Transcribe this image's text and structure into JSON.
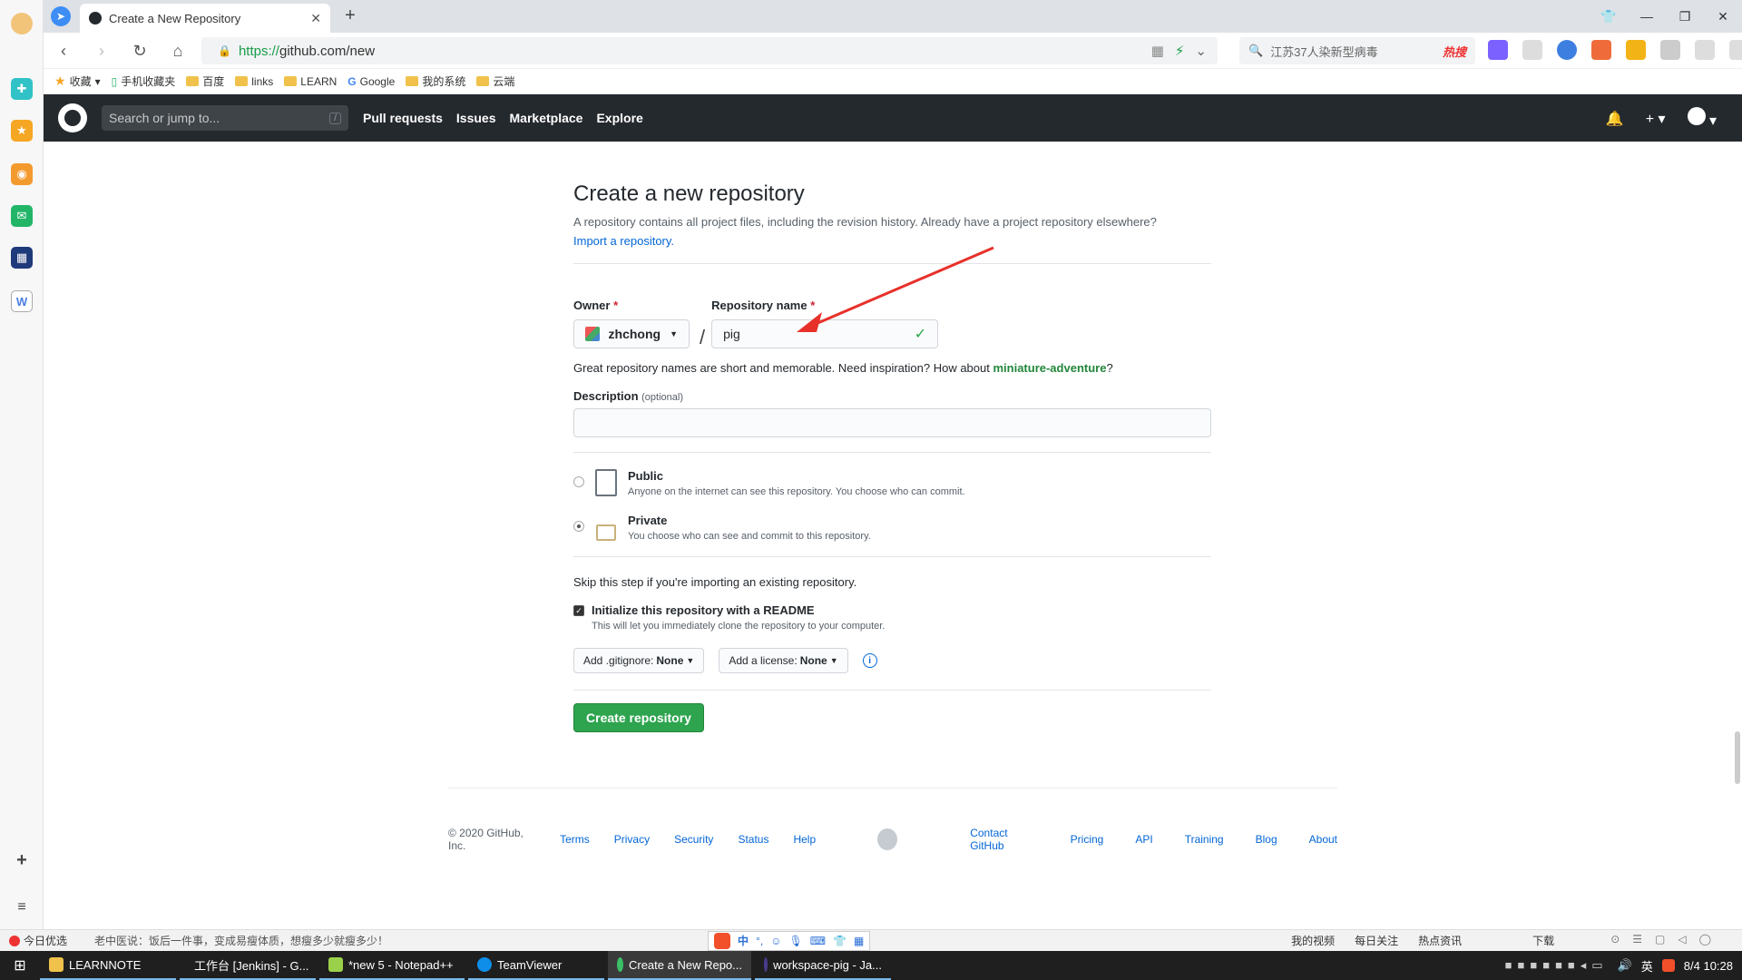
{
  "browser": {
    "tab_title": "Create a New Repository",
    "url_scheme": "https://",
    "url_rest": "github.com/new",
    "search_text": "江苏37人染新型病毒",
    "search_hot": "热搜",
    "new_tab": "+"
  },
  "bookmarks": [
    {
      "label": "收藏"
    },
    {
      "label": "手机收藏夹"
    },
    {
      "label": "百度"
    },
    {
      "label": "links"
    },
    {
      "label": "LEARN"
    },
    {
      "label": "Google"
    },
    {
      "label": "我的系统"
    },
    {
      "label": "云端"
    }
  ],
  "github": {
    "search_placeholder": "Search or jump to...",
    "search_key": "/",
    "nav": [
      "Pull requests",
      "Issues",
      "Marketplace",
      "Explore"
    ]
  },
  "form": {
    "title": "Create a new repository",
    "subtitle": "A repository contains all project files, including the revision history. Already have a project repository elsewhere?",
    "import_link": "Import a repository.",
    "owner_label": "Owner",
    "required_mark": "*",
    "owner_value": "zhchong",
    "repo_label": "Repository name",
    "repo_value": "pig",
    "separator": "/",
    "hint_prefix": "Great repository names are short and memorable. Need inspiration? How about ",
    "hint_suggestion": "miniature-adventure",
    "hint_suffix": "?",
    "description_label": "Description",
    "description_optional": "(optional)",
    "description_value": "",
    "public_label": "Public",
    "public_desc": "Anyone on the internet can see this repository. You choose who can commit.",
    "private_label": "Private",
    "private_desc": "You choose who can see and commit to this repository.",
    "skip_text": "Skip this step if you're importing an existing repository.",
    "init_label": "Initialize this repository with a README",
    "init_desc": "This will let you immediately clone the repository to your computer.",
    "gitignore_prefix": "Add .gitignore:",
    "gitignore_value": "None",
    "license_prefix": "Add a license:",
    "license_value": "None",
    "create_button": "Create repository"
  },
  "footer": {
    "copyright": "© 2020 GitHub, Inc.",
    "left_links": [
      "Terms",
      "Privacy",
      "Security",
      "Status",
      "Help"
    ],
    "right_links": [
      "Contact GitHub",
      "Pricing",
      "API",
      "Training",
      "Blog",
      "About"
    ]
  },
  "statusbar": {
    "left1": "今日优选",
    "news": "老中医说：饭后一件事，变成易瘦体质，想瘦多少就瘦多少！",
    "right": [
      "我的视频",
      "每日关注",
      "热点资讯",
      "下载"
    ]
  },
  "taskbar": {
    "items": [
      "LEARNNOTE",
      "工作台 [Jenkins] - G...",
      "*new 5 - Notepad++",
      "TeamViewer",
      "Create a New Repo...",
      "workspace-pig - Ja..."
    ],
    "lang": "英",
    "clock": "8/4 10:28"
  }
}
